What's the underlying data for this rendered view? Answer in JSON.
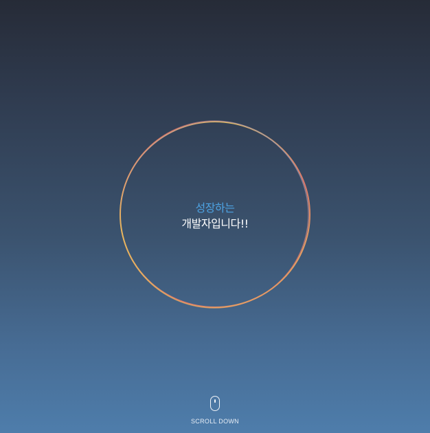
{
  "hero": {
    "line_accent": "성장하는",
    "line_main": "개발자입니다!!",
    "accent_color": "#4da3e3",
    "ring_colors": [
      "#f0c85a",
      "#e67a6a",
      "#b07ab8",
      "#6ea7d8"
    ]
  },
  "scroll": {
    "label": "SCROLL DOWN",
    "icon": "mouse-icon"
  }
}
